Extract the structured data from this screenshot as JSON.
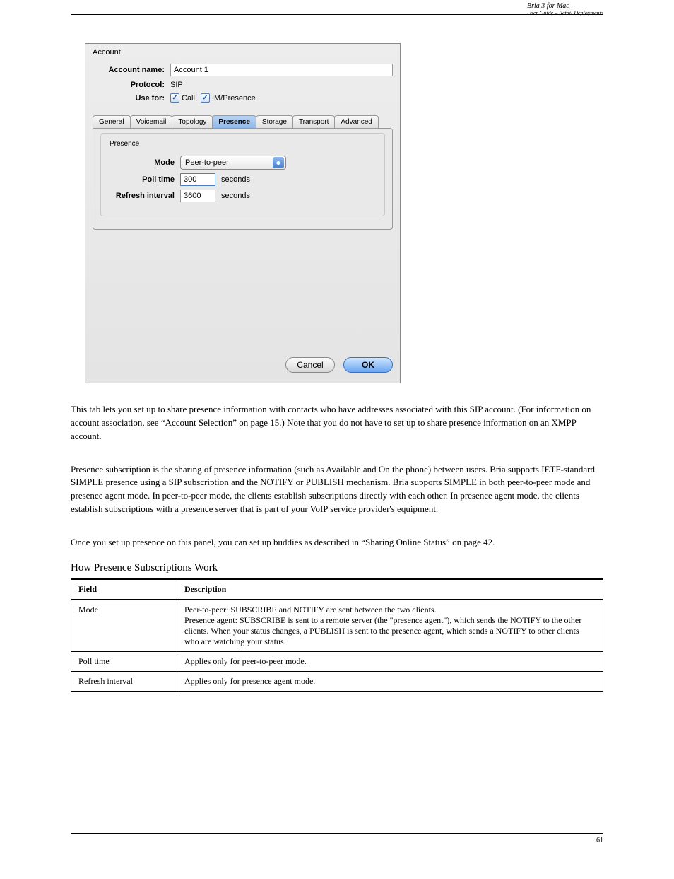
{
  "doc_header": {
    "product": "Bria 3 for Mac",
    "subtitle": "User Guide – Retail Deployments"
  },
  "dialog": {
    "title": "Account",
    "labels": {
      "account_name": "Account name:",
      "protocol": "Protocol:",
      "use_for": "Use for:"
    },
    "account_name_value": "Account 1",
    "protocol_value": "SIP",
    "use_for": {
      "call_checked": true,
      "call_label": "Call",
      "im_checked": true,
      "im_label": "IM/Presence"
    },
    "tabs": [
      "General",
      "Voicemail",
      "Topology",
      "Presence",
      "Storage",
      "Transport",
      "Advanced"
    ],
    "active_tab": 3,
    "presence": {
      "group_title": "Presence",
      "mode_label": "Mode",
      "mode_value": "Peer-to-peer",
      "poll_label": "Poll time",
      "poll_value": "300",
      "poll_unit": "seconds",
      "refresh_label": "Refresh interval",
      "refresh_value": "3600",
      "refresh_unit": "seconds"
    },
    "buttons": {
      "cancel": "Cancel",
      "ok": "OK"
    }
  },
  "body": {
    "para1": "This tab lets you set up to share presence information with contacts who have addresses associated with this SIP account. (For information on account association, see “Account Selection” on page 15.) Note that you do not have to set up to share presence information on an XMPP account.",
    "para2": "Presence subscription is the sharing of presence information (such as Available and On the phone) between users. Bria supports IETF-standard SIMPLE presence using a SIP subscription and the NOTIFY or PUBLISH mechanism. Bria supports SIMPLE in both peer-to-peer mode and presence agent mode. In peer-to-peer mode, the clients establish subscriptions directly with each other. In presence agent mode, the clients establish subscriptions with a presence server that is part of your VoIP service provider's equipment.",
    "para3": "Once you set up presence on this panel, you can set up buddies as described in “Sharing Online Status” on page 42.",
    "heading": "How Presence Subscriptions Work"
  },
  "table": {
    "headers": [
      "Field",
      "Description"
    ],
    "rows": [
      [
        "Mode",
        "Peer-to-peer: SUBSCRIBE and NOTIFY are sent between the two clients.\nPresence agent: SUBSCRIBE is sent to a remote server (the \"presence agent\"), which sends the NOTIFY to the other clients. When your status changes, a PUBLISH is sent to the presence agent, which sends a NOTIFY to other clients who are watching your status."
      ],
      [
        "Poll time",
        "Applies only for peer-to-peer mode."
      ],
      [
        "Refresh interval",
        "Applies only for presence agent mode."
      ]
    ]
  },
  "footer_page": "61"
}
